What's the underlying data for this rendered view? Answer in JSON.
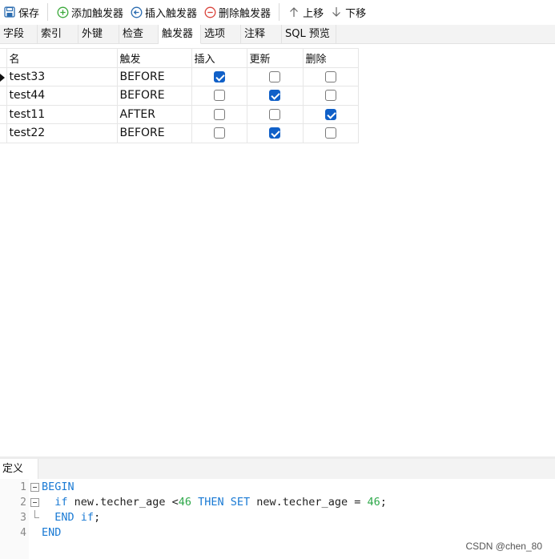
{
  "toolbar": {
    "save": "保存",
    "add_trigger": "添加触发器",
    "insert_trigger": "插入触发器",
    "delete_trigger": "删除触发器",
    "move_up": "上移",
    "move_down": "下移"
  },
  "tabs": [
    "字段",
    "索引",
    "外键",
    "检查",
    "触发器",
    "选项",
    "注释",
    "SQL 预览"
  ],
  "active_tab": "触发器",
  "grid": {
    "columns": [
      "名",
      "触发",
      "插入",
      "更新",
      "删除"
    ],
    "rows": [
      {
        "name": "test33",
        "fire": "BEFORE",
        "insert": true,
        "update": false,
        "delete": false,
        "current": true
      },
      {
        "name": "test44",
        "fire": "BEFORE",
        "insert": false,
        "update": true,
        "delete": false,
        "current": false
      },
      {
        "name": "test11",
        "fire": "AFTER",
        "insert": false,
        "update": false,
        "delete": true,
        "current": false
      },
      {
        "name": "test22",
        "fire": "BEFORE",
        "insert": false,
        "update": true,
        "delete": false,
        "current": false
      }
    ]
  },
  "definition": {
    "tab_label": "定义",
    "lines": [
      {
        "n": "1",
        "tokens": [
          {
            "t": "BEGIN",
            "c": "kw"
          }
        ]
      },
      {
        "n": "2",
        "tokens": [
          {
            "t": "  ",
            "c": ""
          },
          {
            "t": "if",
            "c": "kw"
          },
          {
            "t": " new.techer_age <",
            "c": ""
          },
          {
            "t": "46",
            "c": "num"
          },
          {
            "t": " ",
            "c": ""
          },
          {
            "t": "THEN",
            "c": "kw"
          },
          {
            "t": " ",
            "c": ""
          },
          {
            "t": "SET",
            "c": "kw"
          },
          {
            "t": " new.techer_age = ",
            "c": ""
          },
          {
            "t": "46",
            "c": "num"
          },
          {
            "t": ";",
            "c": ""
          }
        ]
      },
      {
        "n": "3",
        "tokens": [
          {
            "t": "  ",
            "c": ""
          },
          {
            "t": "END",
            "c": "kw"
          },
          {
            "t": " ",
            "c": ""
          },
          {
            "t": "if",
            "c": "kw"
          },
          {
            "t": ";",
            "c": ""
          }
        ]
      },
      {
        "n": "4",
        "tokens": [
          {
            "t": "END",
            "c": "kw"
          }
        ]
      }
    ]
  },
  "watermark": "CSDN @chen_80",
  "colors": {
    "accent": "#1060c8",
    "keyword": "#1a7ad4",
    "number": "#2ea84a"
  },
  "icons": {
    "save": "save-icon",
    "add": "plus-circle-icon",
    "insert": "arrow-left-circle-icon",
    "delete": "minus-circle-icon",
    "up": "arrow-up-icon",
    "down": "arrow-down-icon"
  }
}
